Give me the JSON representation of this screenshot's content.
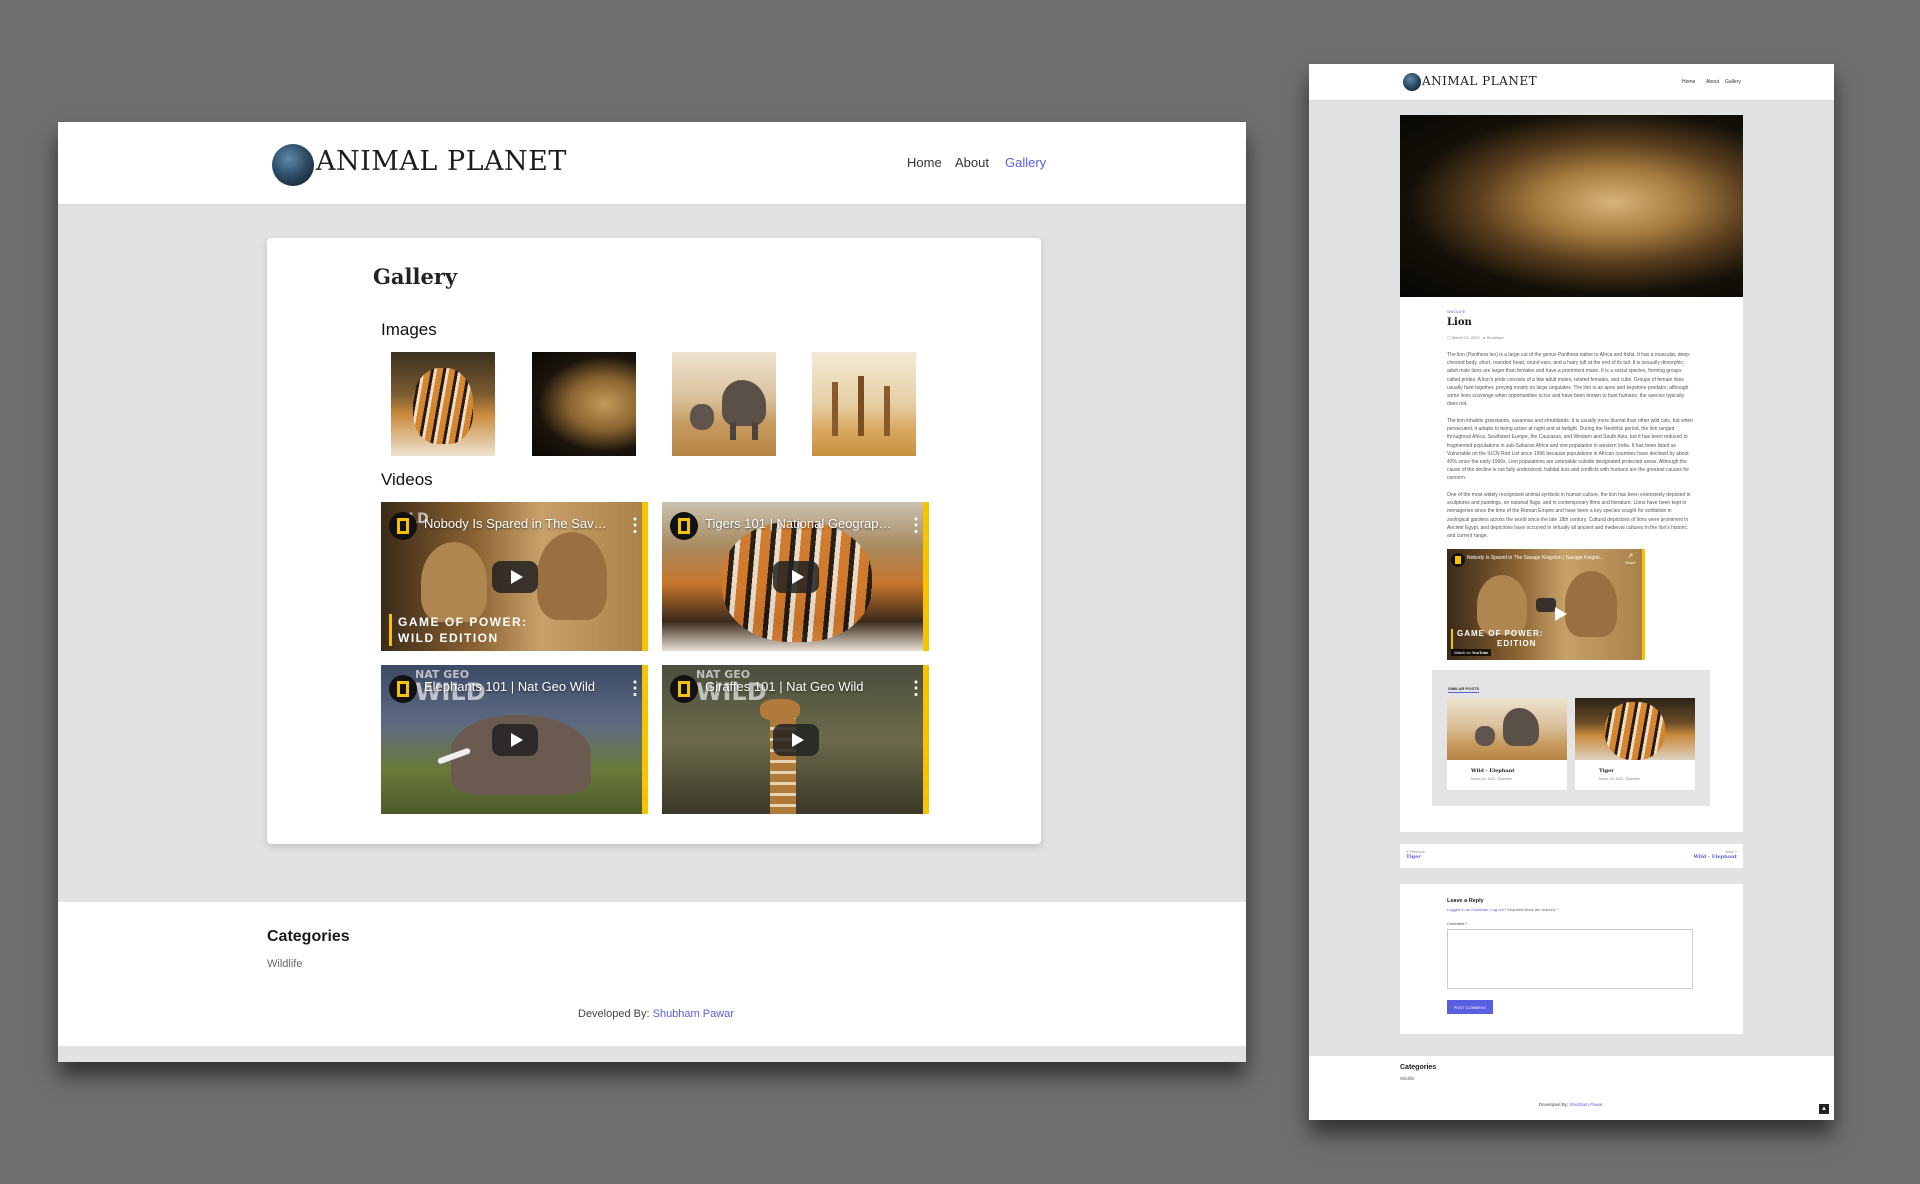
{
  "site": {
    "brand": "ANIMAL PLANET",
    "nav": [
      "Home",
      "About",
      "Gallery"
    ],
    "accent": "#5a5ee0"
  },
  "gallery_page": {
    "title": "Gallery",
    "images_heading": "Images",
    "videos_heading": "Videos",
    "images": [
      "tiger",
      "lion",
      "elephants",
      "giraffes"
    ],
    "videos": [
      {
        "title": "Nobody Is Spared in The Savag...",
        "overlay_line1": "GAME OF POWER:",
        "overlay_line2": "WILD EDITION",
        "bg_text": "ILD"
      },
      {
        "title": "Tigers 101 | National Geograph..."
      },
      {
        "title": "Elephants 101 | Nat Geo Wild",
        "bg_text1": "NAT GEO",
        "bg_text2": "WILD"
      },
      {
        "title": "Giraffes 101 | Nat Geo Wild",
        "bg_text1": "NAT GEO",
        "bg_text2": "WILD"
      }
    ]
  },
  "footer": {
    "categories_heading": "Categories",
    "category": "Wildlife",
    "developed_by": "Developed By:",
    "developer": "Shubham Pawar"
  },
  "post_page": {
    "category_tag": "WILDLIFE",
    "title": "Lion",
    "date": "March 29, 2022",
    "author": "Shubham",
    "paragraphs": [
      "The lion (Panthera leo) is a large cat of the genus Panthera native to Africa and India. It has a muscular, deep-chested body, short, rounded head, round ears, and a hairy tuft at the end of its tail. It is sexually dimorphic; adult male lions are larger than females and have a prominent mane. It is a social species, forming groups called prides. A lion's pride consists of a few adult males, related females, and cubs. Groups of female lions usually hunt together, preying mostly on large ungulates. The lion is an apex and keystone predator; although some lions scavenge when opportunities occur and have been known to hunt humans, the species typically does not.",
      "The lion inhabits grasslands, savannas and shrublands. It is usually more diurnal than other wild cats, but when persecuted, it adapts to being active at night and at twilight. During the Neolithic period, the lion ranged throughout Africa, Southeast Europe, the Caucasus, and Western and South Asia, but it has been reduced to fragmented populations in sub-Saharan Africa and one population in western India. It has been listed as Vulnerable on the IUCN Red List since 1996 because populations in African countries have declined by about 43% since the early 1990s. Lion populations are untenable outside designated protected areas. Although the cause of the decline is not fully understood, habitat loss and conflicts with humans are the greatest causes for concern.",
      "One of the most widely recognised animal symbols in human culture, the lion has been extensively depicted in sculptures and paintings, on national flags, and in contemporary films and literature. Lions have been kept in menageries since the time of the Roman Empire and have been a key species sought for exhibition in zoological gardens across the world since the late 18th century. Cultural depictions of lions were prominent in Ancient Egypt, and depictions have occurred in virtually all ancient and medieval cultures in the lion's historic and current range."
    ],
    "video": {
      "title": "Nobody Is Spared in The Savage Kingdom | Savage Kingdo...",
      "share": "Share",
      "overlay_line1": "GAME OF POWER:",
      "overlay_line2": "EDITION",
      "watch_on": "Watch on",
      "youtube": "YouTube"
    },
    "similar_posts": {
      "heading": "SIMILAR POSTS",
      "items": [
        {
          "title": "Wild - Elephant",
          "date": "March 30, 2022",
          "author": "Shubham"
        },
        {
          "title": "Tiger",
          "date": "March 29, 2022",
          "author": "Shubham"
        }
      ]
    },
    "pagination": {
      "prev_label": "« Previous",
      "prev_title": "Tiger",
      "next_label": "Next »",
      "next_title": "Wild - Elephant"
    },
    "reply": {
      "heading": "Leave a Reply",
      "logged_in": "Logged in as Shubham. Log out?",
      "required": "Required fields are marked *",
      "comment_label": "Comment *",
      "submit": "POST COMMENT"
    }
  }
}
